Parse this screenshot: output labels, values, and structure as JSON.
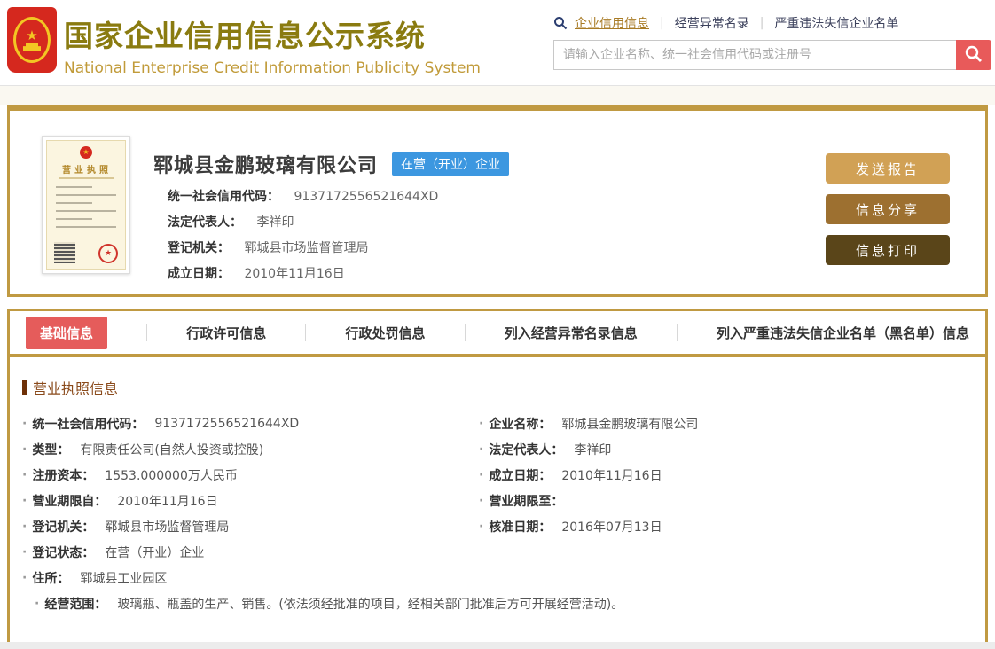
{
  "header": {
    "site_title": "国家企业信用信息公示系统",
    "site_subtitle": "National Enterprise Credit Information Publicity System",
    "nav": [
      {
        "label": "企业信用信息"
      },
      {
        "label": "经营异常名录"
      },
      {
        "label": "严重违法失信企业名单"
      }
    ],
    "search": {
      "placeholder": "请输入企业名称、统一社会信用代码或注册号"
    }
  },
  "icons": {
    "nav_search": "magnifier-icon",
    "search_button": "magnifier-icon",
    "emblem": "prc-national-emblem"
  },
  "colors": {
    "gold_border": "#c09a42",
    "title_gold": "#8a7b10",
    "subtitle_gold": "#c19b3a",
    "active_tab_red": "#e55c5b",
    "search_button_red": "#e85a5a",
    "status_badge_blue": "#3c97e0",
    "button_light": "#d1a155",
    "button_mid": "#9d7030",
    "button_dark": "#5a4519",
    "section_brown": "#8a4a1b"
  },
  "company_card": {
    "name": "郓城县金鹏玻璃有限公司",
    "status_badge": "在营（开业）企业",
    "license_thumb_title": "营业执照",
    "fields": [
      {
        "label": "统一社会信用代码：",
        "value": "9137172556521644XD"
      },
      {
        "label": "法定代表人：",
        "value": "李祥印"
      },
      {
        "label": "登记机关：",
        "value": "郓城县市场监督管理局"
      },
      {
        "label": "成立日期：",
        "value": "2010年11月16日"
      }
    ],
    "actions": [
      "发送报告",
      "信息分享",
      "信息打印"
    ]
  },
  "tabs": {
    "items": [
      "基础信息",
      "行政许可信息",
      "行政处罚信息",
      "列入经营异常名录信息",
      "列入严重违法失信企业名单（黑名单）信息"
    ],
    "active": "基础信息"
  },
  "license_section": {
    "title": "营业执照信息",
    "left": [
      {
        "label": "统一社会信用代码：",
        "value": "9137172556521644XD"
      },
      {
        "label": "类型：",
        "value": "有限责任公司(自然人投资或控股)"
      },
      {
        "label": "注册资本：",
        "value": "1553.000000万人民币"
      },
      {
        "label": "营业期限自：",
        "value": "2010年11月16日"
      },
      {
        "label": "登记机关：",
        "value": "郓城县市场监督管理局"
      },
      {
        "label": "登记状态：",
        "value": "在营（开业）企业"
      },
      {
        "label": "住所：",
        "value": "郓城县工业园区"
      }
    ],
    "right": [
      {
        "label": "企业名称：",
        "value": "郓城县金鹏玻璃有限公司"
      },
      {
        "label": "法定代表人：",
        "value": "李祥印"
      },
      {
        "label": "成立日期：",
        "value": "2010年11月16日"
      },
      {
        "label": "营业期限至：",
        "value": ""
      },
      {
        "label": "核准日期：",
        "value": "2016年07月13日"
      }
    ],
    "scope": {
      "label": "经营范围：",
      "value": "玻璃瓶、瓶盖的生产、销售。(依法须经批准的项目，经相关部门批准后方可开展经营活动)。"
    }
  }
}
